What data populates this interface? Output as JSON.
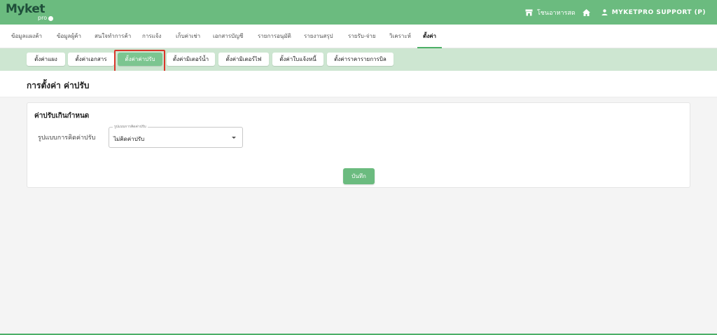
{
  "app": {
    "logo_main": "Myket",
    "logo_sub": "pro"
  },
  "header": {
    "shop_name": "โชนอาหารสด",
    "username": "MYKETPRO SUPPORT (P)",
    "icons": [
      "store-icon",
      "home-icon",
      "user-icon"
    ]
  },
  "main_nav": {
    "tabs": [
      {
        "label": "ข้อมูลแผงค้า"
      },
      {
        "label": "ข้อมูลผู้ค้า"
      },
      {
        "label": "สนใจทำการค้า"
      },
      {
        "label": "การแจ้ง"
      },
      {
        "label": "เก็บค่าเช่า"
      },
      {
        "label": "เอกสารบัญชี"
      },
      {
        "label": "รายการอนุมัติ"
      },
      {
        "label": "รายงานสรุป"
      },
      {
        "label": "รายรับ-จ่าย"
      },
      {
        "label": "วิเคราะห์"
      },
      {
        "label": "ตั้งค่า",
        "active": true
      }
    ]
  },
  "sub_nav": {
    "tabs": [
      {
        "label": "ตั้งค่าแผง"
      },
      {
        "label": "ตั้งค่าเอกสาร"
      },
      {
        "label": "ตั้งค่าค่าปรับ",
        "active": true
      },
      {
        "label": "ตั้งค่ามิเตอร์น้ำ"
      },
      {
        "label": "ตั้งค่ามิเตอร์ไฟ"
      },
      {
        "label": "ตั้งค่าใบแจ้งหนี้"
      },
      {
        "label": "ตั้งค่าราคารายการบิล"
      }
    ]
  },
  "page": {
    "title": "การตั้งค่า ค่าปรับ"
  },
  "late_fee_card": {
    "title": "ค่าปรับเกินกำหนด",
    "field_label": "รูปแบบการคิดค่าปรับ",
    "select_legend": "รูปแบบการคิดค่าปรับ",
    "select_value": "ไม่คิดค่าปรับ",
    "save_label": "บันทึก"
  },
  "colors": {
    "brand_green": "#6bbb7f",
    "subnav_bg": "#cde6d1",
    "highlight_red": "#d9362b"
  }
}
